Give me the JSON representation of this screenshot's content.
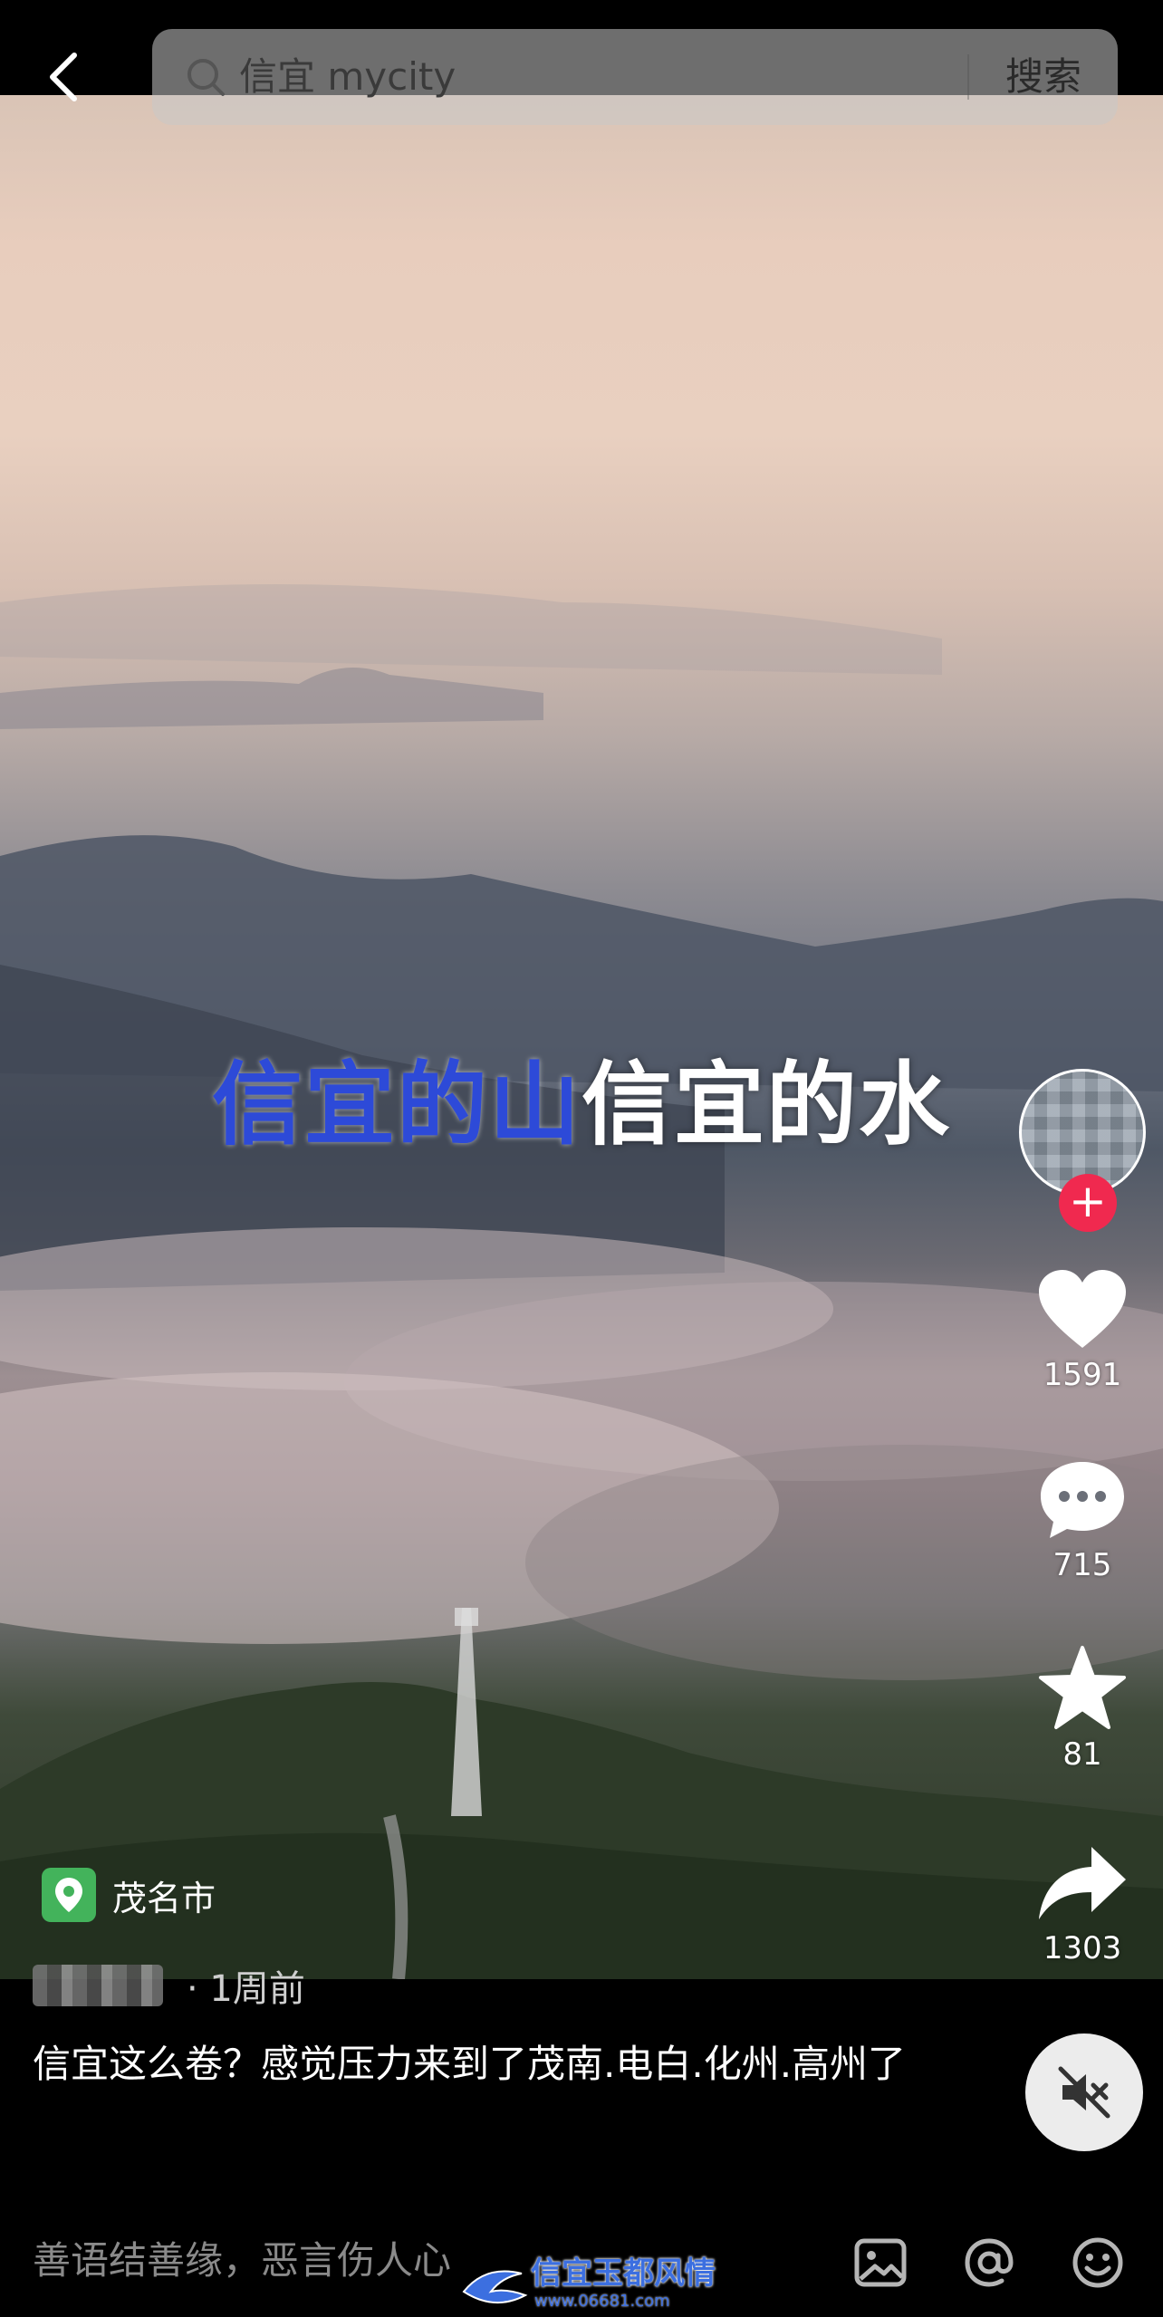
{
  "search": {
    "query": "信宜 mycity",
    "button_label": "搜索"
  },
  "video": {
    "subtitle_highlight": "信宜的山",
    "subtitle_rest": "信宜的水"
  },
  "actions": {
    "likes": "1591",
    "comments": "715",
    "favorites": "81",
    "shares": "1303",
    "follow_symbol": "+"
  },
  "post": {
    "location": "茂名市",
    "time": "· 1周前",
    "caption": "信宜这么卷？感觉压力来到了茂南.电白.化州.高州了"
  },
  "comment_bar": {
    "placeholder": "善语结善缘，恶言伤人心"
  },
  "watermark": {
    "title": "信宜玉都风情",
    "url": "www.06681.com"
  },
  "colors": {
    "follow": "#f0294f",
    "location_badge": "#43b35b",
    "subtitle_highlight": "#2d4ad8"
  },
  "icons": [
    "back-arrow-icon",
    "search-icon",
    "heart-icon",
    "comment-icon",
    "star-icon",
    "share-icon",
    "location-pin-icon",
    "mute-icon",
    "image-icon",
    "at-icon",
    "emoji-icon"
  ]
}
